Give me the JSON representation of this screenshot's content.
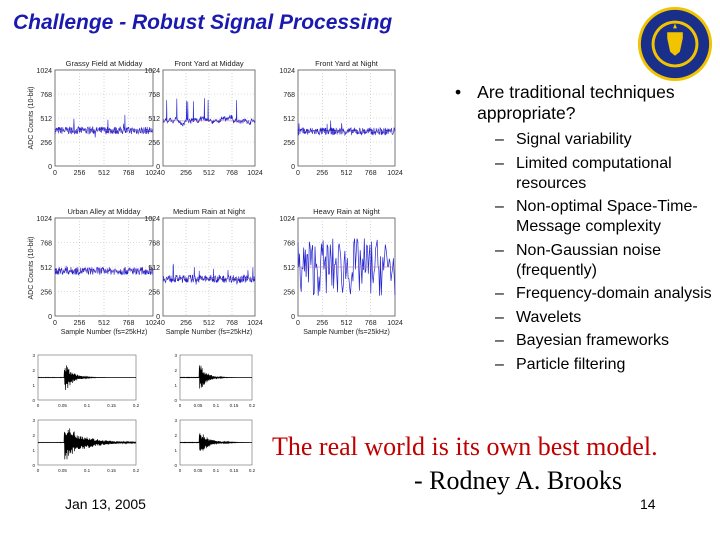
{
  "title": "Challenge - Robust Signal Processing",
  "logo": {
    "text": "UNIVERSITY OF CALIFORNIA · 1868",
    "icon": "university-seal"
  },
  "bullet": {
    "text": "Are traditional techniques appropriate?",
    "items": [
      "Signal variability",
      "Limited computational resources",
      "Non-optimal Space-Time-Message complexity",
      "Non-Gaussian noise (frequently)",
      "Frequency-domain analysis",
      "Wavelets",
      "Bayesian frameworks",
      "Particle filtering"
    ]
  },
  "quote": {
    "line1": "The real world is its own best model.",
    "line2": "- Rodney A. Brooks"
  },
  "footer": {
    "date": "Jan 13, 2005",
    "page": "14"
  },
  "plots": {
    "ylabel": "ADC Counts (10-bit)",
    "xlabel": "Sample Number (fs=25kHz)",
    "panels": [
      {
        "title": "Grassy Field at Midday",
        "yticks": [
          "0",
          "256",
          "512",
          "768",
          "1024"
        ],
        "xticks": [
          "0",
          "256",
          "512",
          "768",
          "1024"
        ],
        "level": 0.37,
        "style": "dense"
      },
      {
        "title": "Front Yard at Midday",
        "yticks": [
          "0",
          "256",
          "512",
          "768",
          "1024"
        ],
        "xticks": [
          "0",
          "256",
          "512",
          "768",
          "1024"
        ],
        "level": 0.47,
        "style": "wander"
      },
      {
        "title": "Front Yard at Night",
        "yticks": [
          "0",
          "256",
          "512",
          "768",
          "1024"
        ],
        "xticks": [
          "0",
          "256",
          "512",
          "768",
          "1024"
        ],
        "level": 0.36,
        "style": "dense"
      },
      {
        "title": "Urban Alley at Midday",
        "yticks": [
          "0",
          "256",
          "512",
          "768",
          "1024"
        ],
        "xticks": [
          "0",
          "256",
          "512",
          "768",
          "1024"
        ],
        "level": 0.46,
        "style": "dense"
      },
      {
        "title": "Medium Rain at Night",
        "yticks": [
          "0",
          "256",
          "512",
          "768",
          "1024"
        ],
        "xticks": [
          "0",
          "256",
          "512",
          "768",
          "1024"
        ],
        "level": 0.38,
        "style": "dense"
      },
      {
        "title": "Heavy Rain at Night",
        "yticks": [
          "0",
          "256",
          "512",
          "768",
          "1024"
        ],
        "xticks": [
          "0",
          "256",
          "512",
          "768",
          "1024"
        ],
        "level": 0.5,
        "style": "wild"
      }
    ],
    "impulse": {
      "yticks": [
        "0",
        "1",
        "2",
        "3"
      ],
      "xticks": [
        "0",
        "0.05",
        "0.1",
        "0.15",
        "0.2"
      ]
    }
  }
}
